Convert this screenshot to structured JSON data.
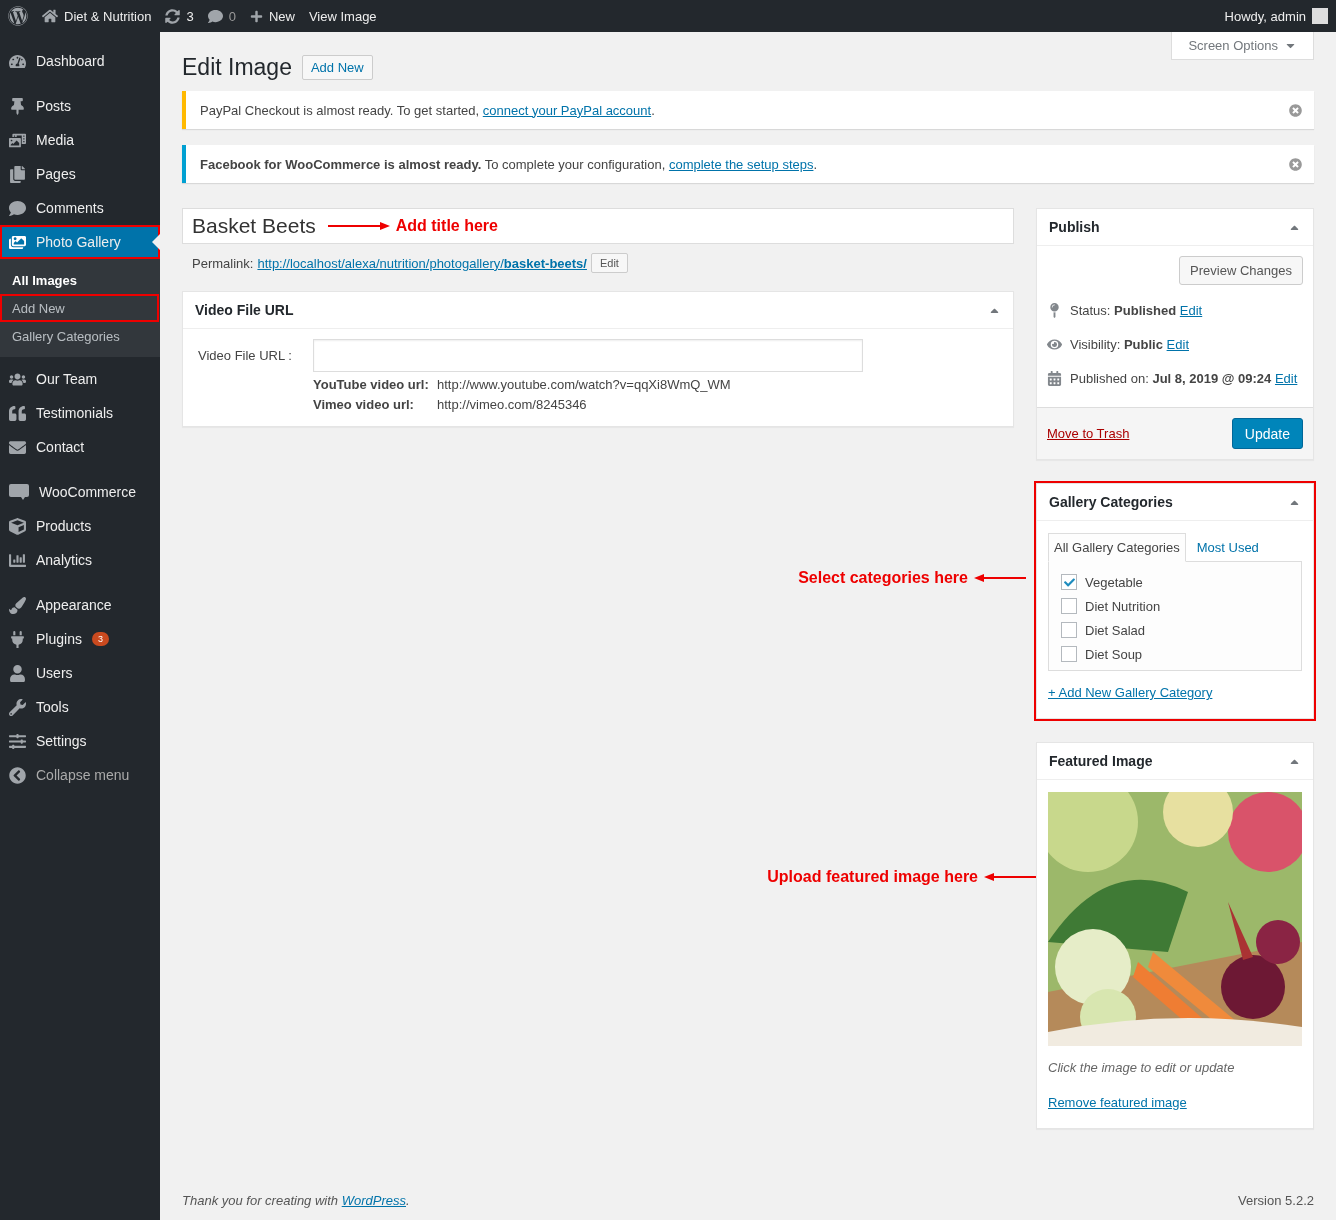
{
  "admin_bar": {
    "site": "Diet & Nutrition",
    "updates": "3",
    "comments": "0",
    "new": "New",
    "view": "View Image",
    "greeting": "Howdy, admin"
  },
  "sidebar": {
    "items": [
      {
        "label": "Dashboard",
        "selected": false,
        "highlighted": false
      },
      {
        "label": "Posts",
        "selected": false,
        "highlighted": false
      },
      {
        "label": "Media",
        "selected": false,
        "highlighted": false
      },
      {
        "label": "Pages",
        "selected": false,
        "highlighted": false
      },
      {
        "label": "Comments",
        "selected": false,
        "highlighted": false
      },
      {
        "label": "Photo Gallery",
        "selected": true,
        "highlighted": true,
        "children": [
          {
            "label": "All Images",
            "selected": true,
            "highlighted": false
          },
          {
            "label": "Add New",
            "selected": false,
            "highlighted": true
          },
          {
            "label": "Gallery Categories",
            "selected": false,
            "highlighted": false
          }
        ]
      },
      {
        "label": "Our Team",
        "selected": false,
        "highlighted": false
      },
      {
        "label": "Testimonials",
        "selected": false,
        "highlighted": false
      },
      {
        "label": "Contact",
        "selected": false,
        "highlighted": false
      },
      {
        "label": "WooCommerce",
        "selected": false,
        "highlighted": false
      },
      {
        "label": "Products",
        "selected": false,
        "highlighted": false
      },
      {
        "label": "Analytics",
        "selected": false,
        "highlighted": false
      },
      {
        "label": "Appearance",
        "selected": false,
        "highlighted": false
      },
      {
        "label": "Plugins",
        "badge": "3",
        "selected": false,
        "highlighted": false
      },
      {
        "label": "Users",
        "selected": false,
        "highlighted": false
      },
      {
        "label": "Tools",
        "selected": false,
        "highlighted": false
      },
      {
        "label": "Settings",
        "selected": false,
        "highlighted": false
      },
      {
        "label": "Collapse menu",
        "kind": "collapse",
        "selected": false,
        "highlighted": false
      }
    ]
  },
  "screen_options": "Screen Options",
  "heading": "Edit Image",
  "add_new": "Add New",
  "notices": [
    {
      "text": "PayPal Checkout is almost ready. To get started, ",
      "link": "connect your PayPal account",
      "after": ".",
      "color": "#ffb900"
    },
    {
      "text": "**Facebook for WooCommerce is almost ready.** To complete your configuration, ",
      "link": "complete the setup steps",
      "after": ".",
      "color": "#00a0d2"
    }
  ],
  "title_field": {
    "value": "Basket Beets",
    "annotation": "Add title here"
  },
  "permalink": {
    "label": "Permalink:",
    "url": "http://localhost/alexa/nutrition/photogallery/",
    "slug": "basket-beets/",
    "button": "Edit"
  },
  "video_box": {
    "title": "Video File URL",
    "expanded": true,
    "field_label": "Video File URL :",
    "hints": [
      {
        "label": "YouTube video url:",
        "value": "http://www.youtube.com/watch?v=qqXi8WmQ_WM"
      },
      {
        "label": "Vimeo video url:",
        "value": "http://vimeo.com/8245346"
      }
    ]
  },
  "publish": {
    "title": "Publish",
    "expanded": true,
    "preview": "Preview Changes",
    "rows": [
      {
        "label": "Status: ",
        "value": "Published",
        "link": "Edit"
      },
      {
        "label": "Visibility: ",
        "value": "Public",
        "link": "Edit"
      },
      {
        "label": "Published on: ",
        "value": "Jul 8, 2019 @ 09:24",
        "link": "Edit"
      }
    ],
    "trash": "Move to Trash",
    "update": "Update"
  },
  "categories": {
    "title": "Gallery Categories",
    "expanded": true,
    "highlighted": true,
    "tabs": [
      {
        "label": "All Gallery Categories",
        "selected": true
      },
      {
        "label": "Most Used",
        "selected": false
      }
    ],
    "items": [
      {
        "label": "Vegetable",
        "checked": true
      },
      {
        "label": "Diet Nutrition",
        "checked": false
      },
      {
        "label": "Diet Salad",
        "checked": false
      },
      {
        "label": "Diet Soup",
        "checked": false
      }
    ],
    "add_link": "+ Add New Gallery Category",
    "annotation": "Select categories here"
  },
  "featured": {
    "title": "Featured Image",
    "expanded": true,
    "caption": "Click the image to edit or update",
    "remove": "Remove featured image",
    "annotation": "Upload featured image here"
  },
  "footer": {
    "text": "Thank you for creating with ",
    "link": "WordPress",
    "after": ".",
    "version": "Version 5.2.2"
  }
}
